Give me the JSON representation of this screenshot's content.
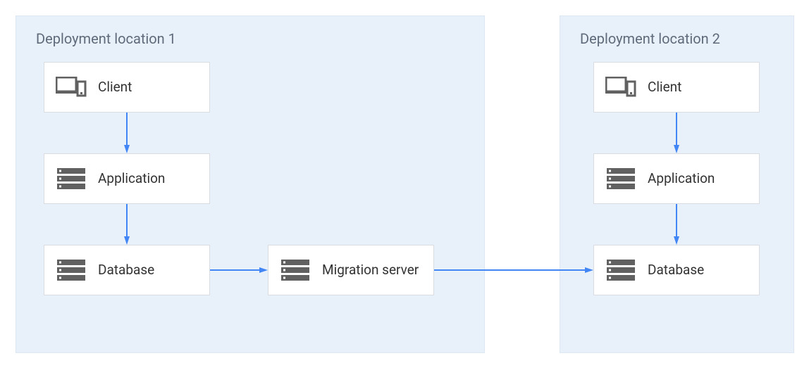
{
  "regions": {
    "loc1": {
      "title": "Deployment location 1"
    },
    "loc2": {
      "title": "Deployment location 2"
    }
  },
  "nodes": {
    "client1": {
      "label": "Client"
    },
    "app1": {
      "label": "Application"
    },
    "db1": {
      "label": "Database"
    },
    "migration": {
      "label": "Migration server"
    },
    "client2": {
      "label": "Client"
    },
    "app2": {
      "label": "Application"
    },
    "db2": {
      "label": "Database"
    }
  },
  "colors": {
    "region_bg": "#e8f0fa",
    "node_border": "#d9dde2",
    "arrow": "#4285f4",
    "icon": "#616161",
    "text": "#333333",
    "title": "#5f6b7a"
  },
  "arrows": [
    {
      "from": "client1",
      "to": "app1",
      "dir": "down"
    },
    {
      "from": "app1",
      "to": "db1",
      "dir": "down"
    },
    {
      "from": "db1",
      "to": "migration",
      "dir": "right"
    },
    {
      "from": "migration",
      "to": "db2",
      "dir": "right"
    },
    {
      "from": "client2",
      "to": "app2",
      "dir": "down"
    },
    {
      "from": "app2",
      "to": "db2",
      "dir": "down"
    }
  ]
}
